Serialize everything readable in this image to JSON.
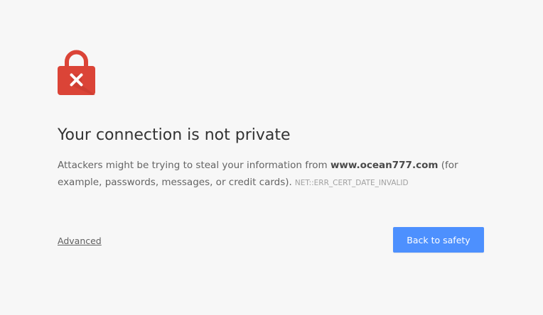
{
  "icon": {
    "name": "lock-with-x-icon",
    "color": "#db4437"
  },
  "heading": "Your connection is not private",
  "message": {
    "prefix": "Attackers might be trying to steal your information from ",
    "domain": "www.ocean777.com",
    "suffix": " (for example, passwords, messages, or credit cards).",
    "error_code": "NET::ERR_CERT_DATE_INVALID"
  },
  "actions": {
    "advanced_label": "Advanced",
    "back_label": "Back to safety",
    "button_color": "#4d90fe"
  }
}
